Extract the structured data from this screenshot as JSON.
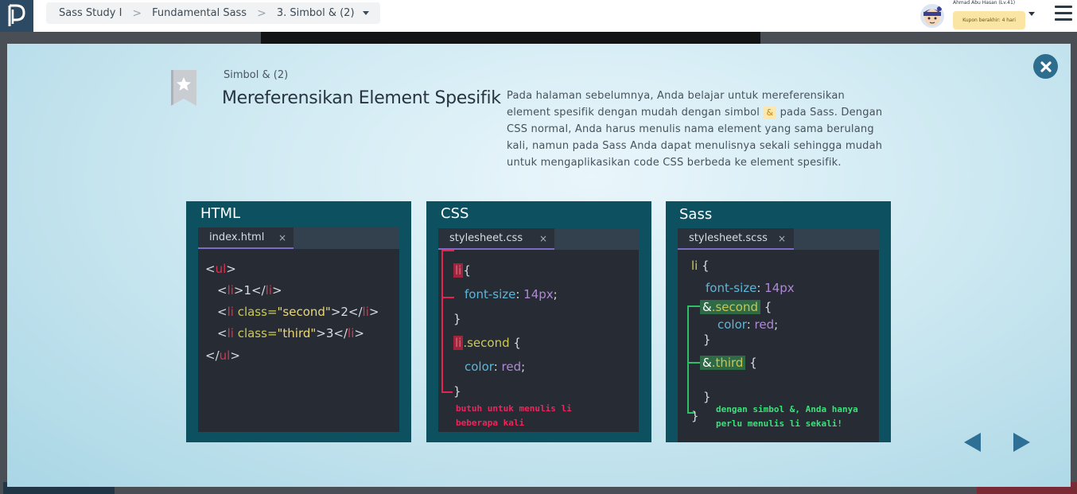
{
  "breadcrumb": {
    "items": [
      "Sass Study I",
      "Fundamental Sass",
      "3. Simbol & (2)"
    ],
    "separator": ">"
  },
  "user": {
    "name": "Ahmad Abu Hasan (Lv.41)",
    "coupon": "Kupon berakhir: 4 hari"
  },
  "modal": {
    "subtitle": "Simbol & (2)",
    "title": "Mereferensikan Element Spesifik",
    "description_before": "Pada halaman sebelumnya, Anda belajar untuk mereferensikan element spesifik dengan mudah dengan simbol",
    "description_symbol": "&",
    "description_after": "pada Sass. Dengan CSS normal, Anda harus menulis nama element yang sama berulang kali, namun pada Sass Anda dapat menulisnya sekali sehingga mudah untuk mengaplikasikan code CSS berbeda ke element spesifik."
  },
  "panels": {
    "html": {
      "title": "HTML",
      "tab": "index.html",
      "tab_close": "×",
      "code": {
        "line1": {
          "open": "<",
          "tag": "ul",
          "close": ">"
        },
        "line2": {
          "open": "<",
          "tag": "li",
          "mid": ">1</",
          "tag2": "li",
          "close": ">"
        },
        "line3": {
          "open": "<",
          "tag": "li",
          "attr": "class=",
          "val": "\"second\"",
          "mid": ">2</",
          "tag2": "li",
          "close": ">"
        },
        "line4": {
          "open": "<",
          "tag": "li",
          "attr": "class=",
          "val": "\"third\"",
          "mid": ">3</",
          "tag2": "li",
          "close": ">"
        },
        "line5": {
          "open": "</",
          "tag": "ul",
          "close": ">"
        }
      }
    },
    "css": {
      "title": "CSS",
      "tab": "stylesheet.css",
      "tab_close": "×",
      "code": {
        "sel1": "li",
        "brace_open": "{",
        "prop1": "font-size",
        "val1": "14px",
        "brace_close": "}",
        "sel2a": "li",
        "sel2b": ".second",
        "prop2": "color",
        "val2": "red"
      },
      "note": [
        "butuh untuk menulis li",
        "beberapa kali"
      ]
    },
    "sass": {
      "title": "Sass",
      "tab": "stylesheet.scss",
      "tab_close": "×",
      "code": {
        "sel1": "li",
        "brace_open": "{",
        "prop1": "font-size",
        "val1": "14px",
        "amp": "&",
        "nest1": ".second",
        "prop2": "color",
        "val2": "red",
        "nest2": ".third",
        "brace_close": "}"
      },
      "note": [
        "dengan simbol &, Anda hanya",
        "perlu menulis li sekali!"
      ]
    }
  },
  "colors": {
    "panel_bg": "#0d5161",
    "editor_bg": "#272b34",
    "accent_nav": "#2e6f96",
    "note_red": "#f0245a",
    "note_green": "#3de07a"
  },
  "icons": {
    "logo": "progate-logo-icon",
    "close": "close-circle-icon",
    "bookmark": "bookmark-star-icon",
    "prev": "arrow-left-icon",
    "next": "arrow-right-icon",
    "menu": "hamburger-menu-icon"
  }
}
